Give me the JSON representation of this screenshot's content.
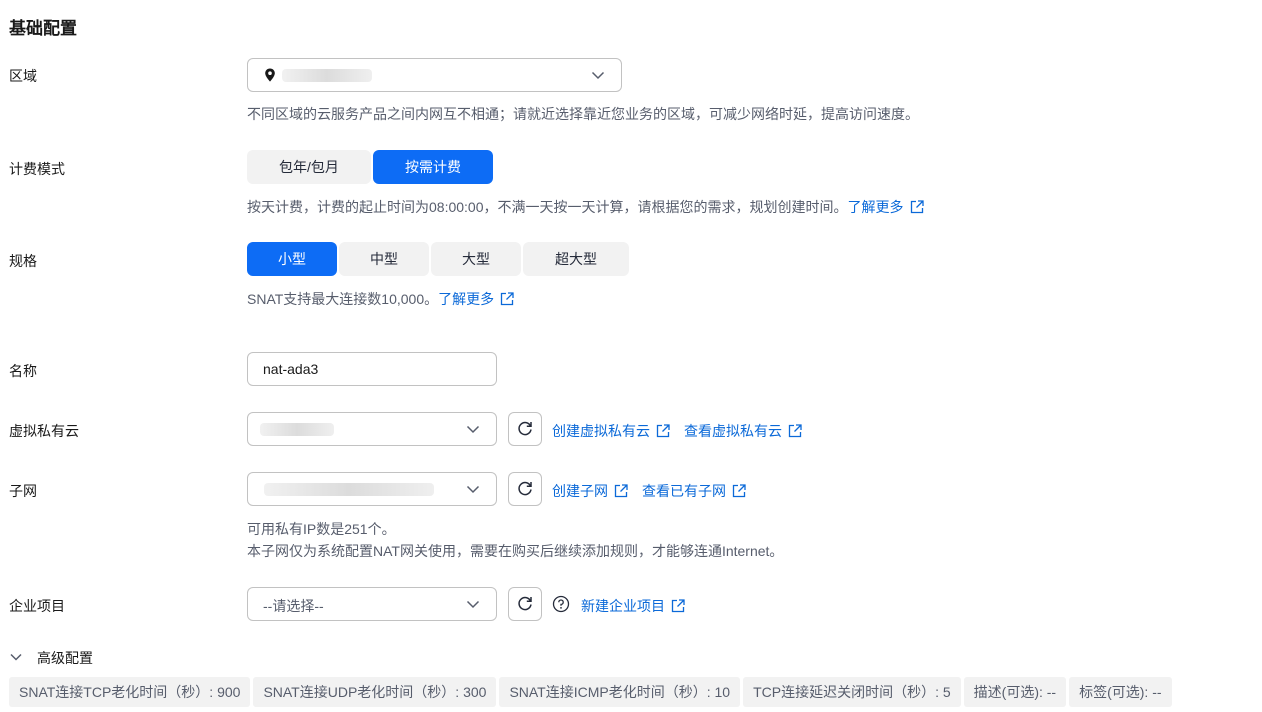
{
  "section_title": "基础配置",
  "region": {
    "label": "区域",
    "hint": "不同区域的云服务产品之间内网互不相通；请就近选择靠近您业务的区域，可减少网络时延，提高访问速度。"
  },
  "billing": {
    "label": "计费模式",
    "options": [
      "包年/包月",
      "按需计费"
    ],
    "selected": "按需计费",
    "hint": "按天计费，计费的起止时间为08:00:00，不满一天按一天计算，请根据您的需求，规划创建时间。",
    "learn_more": "了解更多"
  },
  "spec": {
    "label": "规格",
    "options": [
      "小型",
      "中型",
      "大型",
      "超大型"
    ],
    "selected": "小型",
    "hint": "SNAT支持最大连接数10,000。",
    "learn_more": "了解更多"
  },
  "name": {
    "label": "名称",
    "value": "nat-ada3"
  },
  "vpc": {
    "label": "虚拟私有云",
    "create_link": "创建虚拟私有云",
    "view_link": "查看虚拟私有云"
  },
  "subnet": {
    "label": "子网",
    "create_link": "创建子网",
    "view_link": "查看已有子网",
    "hint_line1": "可用私有IP数是251个。",
    "hint_line2": "本子网仅为系统配置NAT网关使用，需要在购买后继续添加规则，才能够连通Internet。"
  },
  "enterprise_project": {
    "label": "企业项目",
    "placeholder": "--请选择--",
    "create_link": "新建企业项目"
  },
  "advanced": {
    "label": "高级配置",
    "tags": [
      "SNAT连接TCP老化时间（秒）: 900",
      "SNAT连接UDP老化时间（秒）: 300",
      "SNAT连接ICMP老化时间（秒）: 10",
      "TCP连接延迟关闭时间（秒）: 5",
      "描述(可选): --",
      "标签(可选): --"
    ]
  },
  "colors": {
    "primary": "#0d6cf5",
    "link": "#0b69d8",
    "hint_text": "#575d6c"
  },
  "icons": [
    "location-pin-icon",
    "chevron-down-icon",
    "external-link-icon",
    "refresh-icon",
    "help-circle-icon",
    "chevron-collapse-icon"
  ]
}
